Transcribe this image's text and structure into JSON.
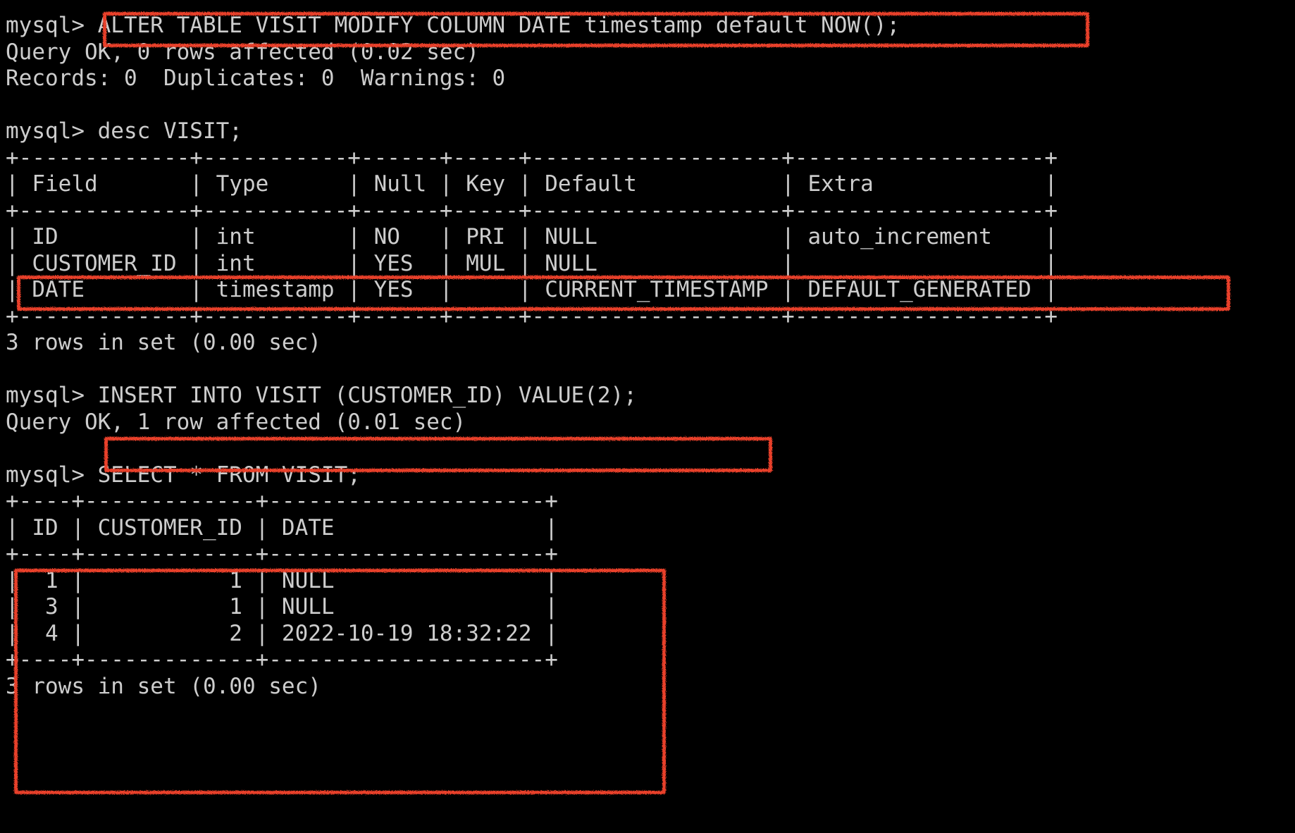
{
  "terminal": {
    "background_color": "#000000",
    "text_color": "#cdcdcd",
    "annotation_color": "#e8402a",
    "prompt": "mysql>",
    "lines": [
      "mysql> ALTER TABLE VISIT MODIFY COLUMN DATE timestamp default NOW();",
      "Query OK, 0 rows affected (0.02 sec)",
      "Records: 0  Duplicates: 0  Warnings: 0",
      "",
      "mysql> desc VISIT;",
      "+-------------+-----------+------+-----+-------------------+-------------------+",
      "| Field       | Type      | Null | Key | Default           | Extra             |",
      "+-------------+-----------+------+-----+-------------------+-------------------+",
      "| ID          | int       | NO   | PRI | NULL              | auto_increment    |",
      "| CUSTOMER_ID | int       | YES  | MUL | NULL              |                   |",
      "| DATE        | timestamp | YES  |     | CURRENT_TIMESTAMP | DEFAULT_GENERATED |",
      "+-------------+-----------+------+-----+-------------------+-------------------+",
      "3 rows in set (0.00 sec)",
      "",
      "mysql> INSERT INTO VISIT (CUSTOMER_ID) VALUE(2);",
      "Query OK, 1 row affected (0.01 sec)",
      "",
      "mysql> SELECT * FROM VISIT;",
      "+----+-------------+---------------------+",
      "| ID | CUSTOMER_ID | DATE                |",
      "+----+-------------+---------------------+",
      "|  1 |           1 | NULL                |",
      "|  3 |           1 | NULL                |",
      "|  4 |           2 | 2022-10-19 18:32:22 |",
      "+----+-------------+---------------------+",
      "3 rows in set (0.00 sec)"
    ],
    "commands": [
      {
        "name": "alter-table-statement",
        "text": "ALTER TABLE VISIT MODIFY COLUMN DATE timestamp default NOW();",
        "result": "Query OK, 0 rows affected (0.02 sec)",
        "detail": "Records: 0  Duplicates: 0  Warnings: 0"
      },
      {
        "name": "desc-statement",
        "text": "desc VISIT;",
        "result": "3 rows in set (0.00 sec)"
      },
      {
        "name": "insert-statement",
        "text": "INSERT INTO VISIT (CUSTOMER_ID) VALUE(2);",
        "result": "Query OK, 1 row affected (0.01 sec)"
      },
      {
        "name": "select-statement",
        "text": "SELECT * FROM VISIT;",
        "result": "3 rows in set (0.00 sec)"
      }
    ]
  },
  "desc_table": {
    "columns": [
      "Field",
      "Type",
      "Null",
      "Key",
      "Default",
      "Extra"
    ],
    "rows": [
      [
        "ID",
        "int",
        "NO",
        "PRI",
        "NULL",
        "auto_increment"
      ],
      [
        "CUSTOMER_ID",
        "int",
        "YES",
        "MUL",
        "NULL",
        ""
      ],
      [
        "DATE",
        "timestamp",
        "YES",
        "",
        "CURRENT_TIMESTAMP",
        "DEFAULT_GENERATED"
      ]
    ],
    "footer": "3 rows in set (0.00 sec)"
  },
  "select_table": {
    "columns": [
      "ID",
      "CUSTOMER_ID",
      "DATE"
    ],
    "rows": [
      [
        "1",
        "1",
        "NULL"
      ],
      [
        "3",
        "1",
        "NULL"
      ],
      [
        "4",
        "2",
        "2022-10-19 18:32:22"
      ]
    ],
    "footer": "3 rows in set (0.00 sec)"
  },
  "annotations": [
    {
      "name": "highlight-alter-statement",
      "target": "ALTER TABLE VISIT MODIFY COLUMN DATE timestamp default NOW();"
    },
    {
      "name": "highlight-date-column-row",
      "target": "| DATE        | timestamp | YES  |     | CURRENT_TIMESTAMP | DEFAULT_GENERATED |"
    },
    {
      "name": "highlight-insert-statement",
      "target": "INSERT INTO VISIT (CUSTOMER_ID) VALUE(2);"
    },
    {
      "name": "highlight-select-result-table",
      "target": "+----+-------------+---------------------+"
    }
  ]
}
